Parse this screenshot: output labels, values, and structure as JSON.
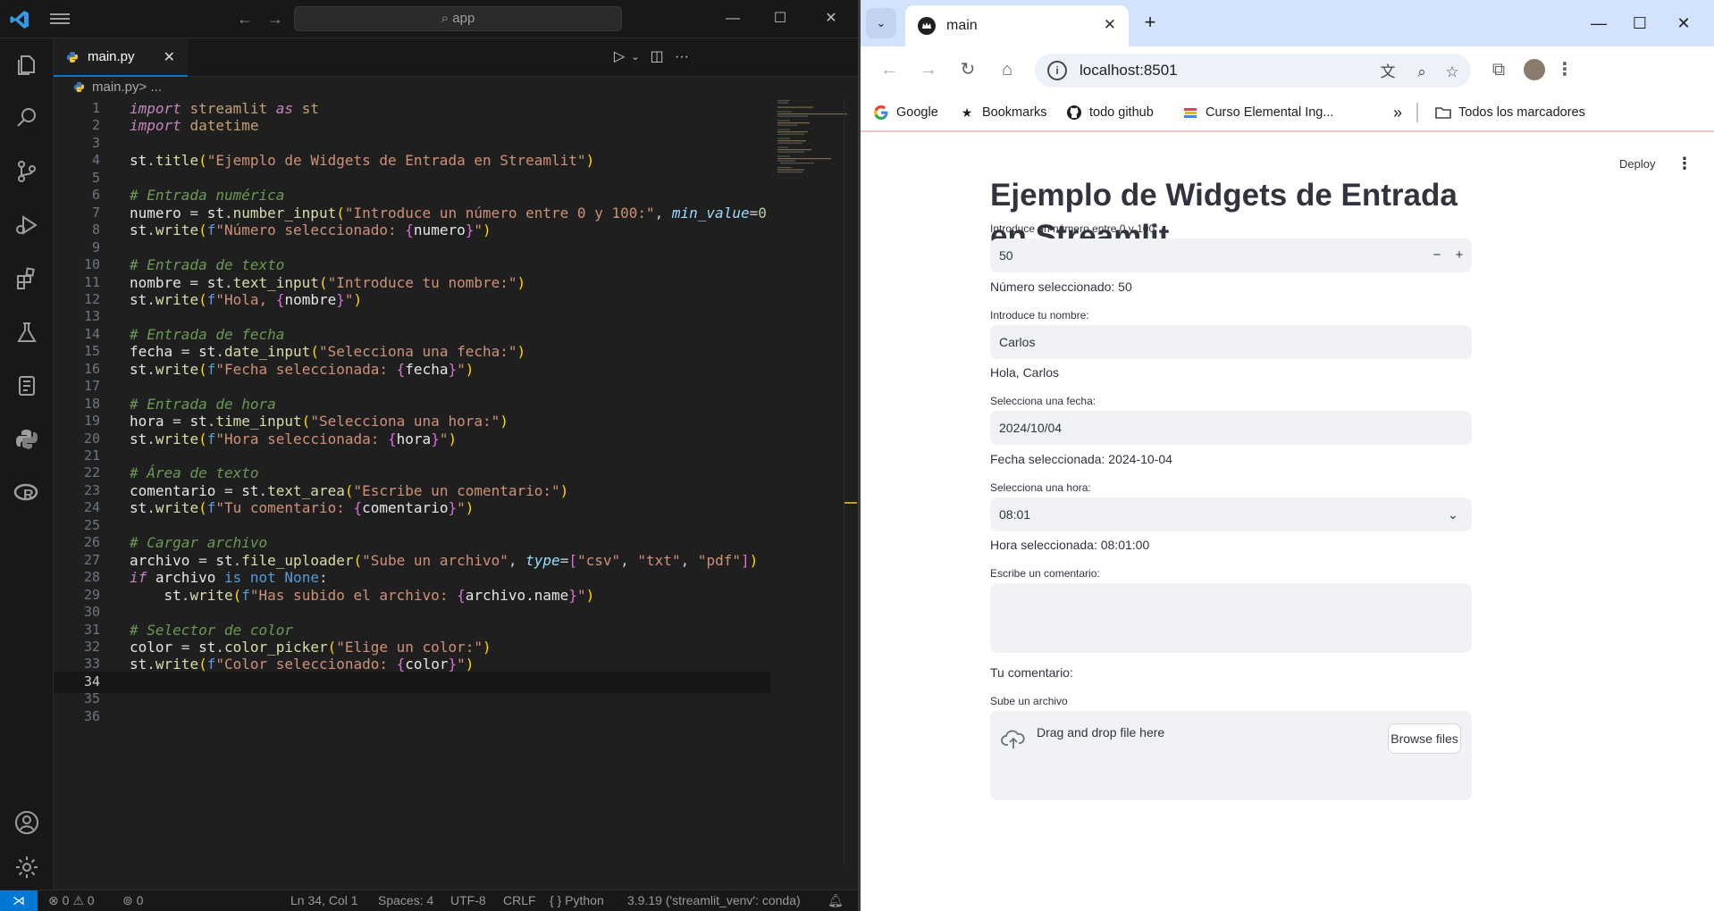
{
  "vscode": {
    "search_placeholder": "app",
    "tab": {
      "label": "main.py",
      "close": "✕"
    },
    "breadcrumb": {
      "file": "main.py",
      "rest": " > ..."
    },
    "code": [
      [
        [
          "kw",
          "import"
        ],
        [
          "t",
          " "
        ],
        [
          "mod",
          "streamlit"
        ],
        [
          "t",
          " "
        ],
        [
          "kw",
          "as"
        ],
        [
          "t",
          " "
        ],
        [
          "mod",
          "st"
        ]
      ],
      [
        [
          "kw",
          "import"
        ],
        [
          "t",
          " "
        ],
        [
          "mod",
          "datetime"
        ]
      ],
      [],
      [
        [
          "wh",
          "st"
        ],
        [
          "t",
          "."
        ],
        [
          "fn",
          "title"
        ],
        [
          "br",
          "("
        ],
        [
          "str",
          "\"Ejemplo de Widgets de Entrada en Streamlit\""
        ],
        [
          "br",
          ")"
        ]
      ],
      [],
      [
        [
          "cm",
          "# Entrada numérica"
        ]
      ],
      [
        [
          "wh",
          "numero"
        ],
        [
          "t",
          " = "
        ],
        [
          "wh",
          "st"
        ],
        [
          "t",
          "."
        ],
        [
          "fn",
          "number_input"
        ],
        [
          "br",
          "("
        ],
        [
          "str",
          "\"Introduce un número entre 0 y 100:\""
        ],
        [
          "t",
          ", "
        ],
        [
          "prm",
          "min_value"
        ],
        [
          "t",
          "="
        ],
        [
          "num",
          "0"
        ]
      ],
      [
        [
          "wh",
          "st"
        ],
        [
          "t",
          "."
        ],
        [
          "fn",
          "write"
        ],
        [
          "br",
          "("
        ],
        [
          "kw2",
          "f"
        ],
        [
          "str",
          "\"Número seleccionado: "
        ],
        [
          "br2",
          "{"
        ],
        [
          "wh",
          "numero"
        ],
        [
          "br2",
          "}"
        ],
        [
          "str",
          "\""
        ],
        [
          "br",
          ")"
        ]
      ],
      [],
      [
        [
          "cm",
          "# Entrada de texto"
        ]
      ],
      [
        [
          "wh",
          "nombre"
        ],
        [
          "t",
          " = "
        ],
        [
          "wh",
          "st"
        ],
        [
          "t",
          "."
        ],
        [
          "fn",
          "text_input"
        ],
        [
          "br",
          "("
        ],
        [
          "str",
          "\"Introduce tu nombre:\""
        ],
        [
          "br",
          ")"
        ]
      ],
      [
        [
          "wh",
          "st"
        ],
        [
          "t",
          "."
        ],
        [
          "fn",
          "write"
        ],
        [
          "br",
          "("
        ],
        [
          "kw2",
          "f"
        ],
        [
          "str",
          "\"Hola, "
        ],
        [
          "br2",
          "{"
        ],
        [
          "wh",
          "nombre"
        ],
        [
          "br2",
          "}"
        ],
        [
          "str",
          "\""
        ],
        [
          "br",
          ")"
        ]
      ],
      [],
      [
        [
          "cm",
          "# Entrada de fecha"
        ]
      ],
      [
        [
          "wh",
          "fecha"
        ],
        [
          "t",
          " = "
        ],
        [
          "wh",
          "st"
        ],
        [
          "t",
          "."
        ],
        [
          "fn",
          "date_input"
        ],
        [
          "br",
          "("
        ],
        [
          "str",
          "\"Selecciona una fecha:\""
        ],
        [
          "br",
          ")"
        ]
      ],
      [
        [
          "wh",
          "st"
        ],
        [
          "t",
          "."
        ],
        [
          "fn",
          "write"
        ],
        [
          "br",
          "("
        ],
        [
          "kw2",
          "f"
        ],
        [
          "str",
          "\"Fecha seleccionada: "
        ],
        [
          "br2",
          "{"
        ],
        [
          "wh",
          "fecha"
        ],
        [
          "br2",
          "}"
        ],
        [
          "str",
          "\""
        ],
        [
          "br",
          ")"
        ]
      ],
      [],
      [
        [
          "cm",
          "# Entrada de hora"
        ]
      ],
      [
        [
          "wh",
          "hora"
        ],
        [
          "t",
          " = "
        ],
        [
          "wh",
          "st"
        ],
        [
          "t",
          "."
        ],
        [
          "fn",
          "time_input"
        ],
        [
          "br",
          "("
        ],
        [
          "str",
          "\"Selecciona una hora:\""
        ],
        [
          "br",
          ")"
        ]
      ],
      [
        [
          "wh",
          "st"
        ],
        [
          "t",
          "."
        ],
        [
          "fn",
          "write"
        ],
        [
          "br",
          "("
        ],
        [
          "kw2",
          "f"
        ],
        [
          "str",
          "\"Hora seleccionada: "
        ],
        [
          "br2",
          "{"
        ],
        [
          "wh",
          "hora"
        ],
        [
          "br2",
          "}"
        ],
        [
          "str",
          "\""
        ],
        [
          "br",
          ")"
        ]
      ],
      [],
      [
        [
          "cm",
          "# Área de texto"
        ]
      ],
      [
        [
          "wh",
          "comentario"
        ],
        [
          "t",
          " = "
        ],
        [
          "wh",
          "st"
        ],
        [
          "t",
          "."
        ],
        [
          "fn",
          "text_area"
        ],
        [
          "br",
          "("
        ],
        [
          "str",
          "\"Escribe un comentario:\""
        ],
        [
          "br",
          ")"
        ]
      ],
      [
        [
          "wh",
          "st"
        ],
        [
          "t",
          "."
        ],
        [
          "fn",
          "write"
        ],
        [
          "br",
          "("
        ],
        [
          "kw2",
          "f"
        ],
        [
          "str",
          "\"Tu comentario: "
        ],
        [
          "br2",
          "{"
        ],
        [
          "wh",
          "comentario"
        ],
        [
          "br2",
          "}"
        ],
        [
          "str",
          "\""
        ],
        [
          "br",
          ")"
        ]
      ],
      [],
      [
        [
          "cm",
          "# Cargar archivo"
        ]
      ],
      [
        [
          "wh",
          "archivo"
        ],
        [
          "t",
          " = "
        ],
        [
          "wh",
          "st"
        ],
        [
          "t",
          "."
        ],
        [
          "fn",
          "file_uploader"
        ],
        [
          "br",
          "("
        ],
        [
          "str",
          "\"Sube un archivo\""
        ],
        [
          "t",
          ", "
        ],
        [
          "prm",
          "type"
        ],
        [
          "t",
          "="
        ],
        [
          "br2",
          "["
        ],
        [
          "str",
          "\"csv\""
        ],
        [
          "t",
          ", "
        ],
        [
          "str",
          "\"txt\""
        ],
        [
          "t",
          ", "
        ],
        [
          "str",
          "\"pdf\""
        ],
        [
          "br2",
          "]"
        ],
        [
          "br",
          ")"
        ]
      ],
      [
        [
          "kw",
          "if"
        ],
        [
          "t",
          " "
        ],
        [
          "wh",
          "archivo"
        ],
        [
          "t",
          " "
        ],
        [
          "kw2",
          "is not"
        ],
        [
          "t",
          " "
        ],
        [
          "kw2",
          "None"
        ],
        [
          "t",
          ":"
        ]
      ],
      [
        [
          "t",
          "    "
        ],
        [
          "wh",
          "st"
        ],
        [
          "t",
          "."
        ],
        [
          "fn",
          "write"
        ],
        [
          "br",
          "("
        ],
        [
          "kw2",
          "f"
        ],
        [
          "str",
          "\"Has subido el archivo: "
        ],
        [
          "br2",
          "{"
        ],
        [
          "wh",
          "archivo.name"
        ],
        [
          "br2",
          "}"
        ],
        [
          "str",
          "\""
        ],
        [
          "br",
          ")"
        ]
      ],
      [],
      [
        [
          "cm",
          "# Selector de color"
        ]
      ],
      [
        [
          "wh",
          "color"
        ],
        [
          "t",
          " = "
        ],
        [
          "wh",
          "st"
        ],
        [
          "t",
          "."
        ],
        [
          "fn",
          "color_picker"
        ],
        [
          "br",
          "("
        ],
        [
          "str",
          "\"Elige un color:\""
        ],
        [
          "br",
          ")"
        ]
      ],
      [
        [
          "wh",
          "st"
        ],
        [
          "t",
          "."
        ],
        [
          "fn",
          "write"
        ],
        [
          "br",
          "("
        ],
        [
          "kw2",
          "f"
        ],
        [
          "str",
          "\"Color seleccionado: "
        ],
        [
          "br2",
          "{"
        ],
        [
          "wh",
          "color"
        ],
        [
          "br2",
          "}"
        ],
        [
          "str",
          "\""
        ],
        [
          "br",
          ")"
        ]
      ],
      [],
      [],
      []
    ],
    "current_line": 34,
    "status": {
      "errors": "0",
      "warnings": "0",
      "ports": "0",
      "position": "Ln 34, Col 1",
      "spaces": "Spaces: 4",
      "encoding": "UTF-8",
      "eol": "CRLF",
      "language": "Python",
      "interpreter": "3.9.19 ('streamlit_venv': conda)"
    }
  },
  "chrome": {
    "tab_title": "main",
    "url": "localhost:8501",
    "bookmarks": [
      {
        "label": "Google",
        "icon": "google-icon"
      },
      {
        "label": "Bookmarks",
        "icon": "star-icon"
      },
      {
        "label": "todo github",
        "icon": "github-icon"
      },
      {
        "label": "Curso Elemental Ing...",
        "icon": "book-icon"
      }
    ],
    "all_bookmarks": "Todos los marcadores",
    "more_bookmarks": "»"
  },
  "streamlit": {
    "deploy": "Deploy",
    "title": "Ejemplo de Widgets de Entrada en Streamlit",
    "number_label": "Introduce un número entre 0 y 100:",
    "number_value": "50",
    "number_minus": "−",
    "number_plus": "+",
    "number_result": "Número seleccionado: 50",
    "name_label": "Introduce tu nombre:",
    "name_value": "Carlos",
    "name_result": "Hola, Carlos",
    "date_label": "Selecciona una fecha:",
    "date_value": "2024/10/04",
    "date_result": "Fecha seleccionada: 2024-10-04",
    "time_label": "Selecciona una hora:",
    "time_value": "08:01",
    "time_result": "Hora seleccionada: 08:01:00",
    "comment_label": "Escribe un comentario:",
    "comment_value": "",
    "comment_result": "Tu comentario:",
    "upload_label": "Sube un archivo",
    "upload_drag": "Drag and drop file here",
    "upload_button": "Browse files"
  }
}
